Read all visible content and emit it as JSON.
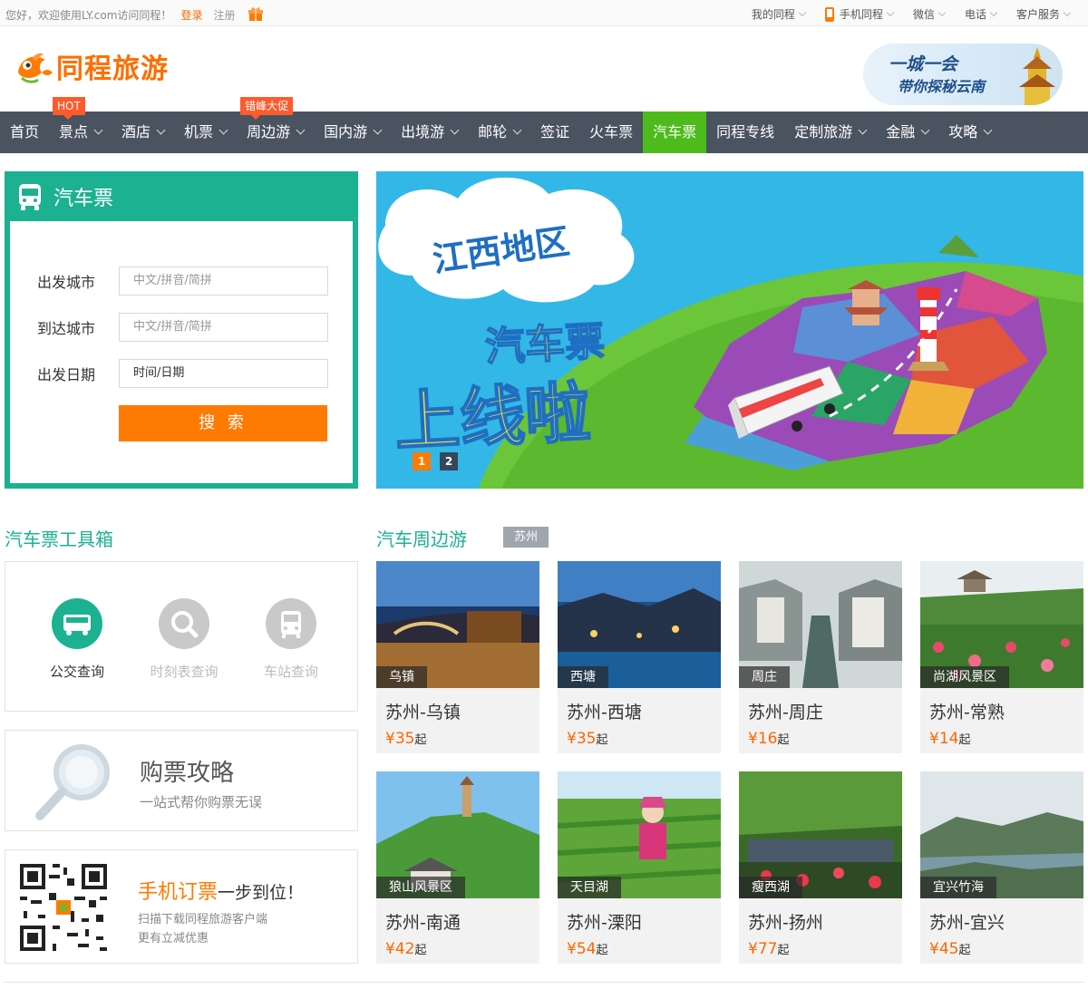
{
  "topbar": {
    "welcome": "您好，欢迎使用LY.com访问同程！",
    "login": "登录",
    "register": "注册",
    "links": [
      "我的同程",
      "手机同程",
      "微信",
      "电话",
      "客户服务"
    ]
  },
  "header": {
    "logo_text": "同程旅游",
    "promo_line1": "一城一会",
    "promo_line2": "带你探秘云南"
  },
  "nav": {
    "items": [
      {
        "label": "首页"
      },
      {
        "label": "景点",
        "tag": "HOT"
      },
      {
        "label": "酒店"
      },
      {
        "label": "机票"
      },
      {
        "label": "周边游",
        "tag": "错峰大促"
      },
      {
        "label": "国内游"
      },
      {
        "label": "出境游"
      },
      {
        "label": "邮轮"
      },
      {
        "label": "签证"
      },
      {
        "label": "火车票"
      },
      {
        "label": "汽车票"
      },
      {
        "label": "同程专线"
      },
      {
        "label": "定制旅游"
      },
      {
        "label": "金融"
      },
      {
        "label": "攻略"
      }
    ]
  },
  "search": {
    "title": "汽车票",
    "from_label": "出发城市",
    "from_placeholder": "中文/拼音/简拼",
    "to_label": "到达城市",
    "to_placeholder": "中文/拼音/简拼",
    "date_label": "出发日期",
    "date_value": "时间/日期",
    "button": "搜 索"
  },
  "banner": {
    "region": "江西地区",
    "line1": "汽车票",
    "line2": "上线啦",
    "pages": [
      "1",
      "2"
    ],
    "active_page": 1
  },
  "toolbox": {
    "title": "汽车票工具箱",
    "tools": [
      {
        "label": "公交查询",
        "icon": "bus-icon",
        "active": true
      },
      {
        "label": "时刻表查询",
        "icon": "search-icon",
        "active": false
      },
      {
        "label": "车站查询",
        "icon": "station-icon",
        "active": false
      }
    ]
  },
  "guide": {
    "title": "购票攻略",
    "subtitle": "一站式帮你购票无误"
  },
  "mobile": {
    "title_highlight": "手机订票",
    "title_rest": "一步到位！",
    "line1": "扫描下载同程旅游客户端",
    "line2": "更有立减优惠"
  },
  "nearby": {
    "title": "汽车周边游",
    "city": "苏州",
    "cards": [
      {
        "place": "乌镇",
        "route": "苏州-乌镇",
        "price": "¥35",
        "suffix": "起"
      },
      {
        "place": "西塘",
        "route": "苏州-西塘",
        "price": "¥35",
        "suffix": "起"
      },
      {
        "place": "周庄",
        "route": "苏州-周庄",
        "price": "¥16",
        "suffix": "起"
      },
      {
        "place": "尚湖风景区",
        "route": "苏州-常熟",
        "price": "¥14",
        "suffix": "起"
      },
      {
        "place": "狼山风景区",
        "route": "苏州-南通",
        "price": "¥42",
        "suffix": "起"
      },
      {
        "place": "天目湖",
        "route": "苏州-溧阳",
        "price": "¥54",
        "suffix": "起"
      },
      {
        "place": "瘦西湖",
        "route": "苏州-扬州",
        "price": "¥77",
        "suffix": "起"
      },
      {
        "place": "宜兴竹海",
        "route": "苏州-宜兴",
        "price": "¥45",
        "suffix": "起"
      }
    ]
  },
  "colors": {
    "brand_orange": "#ff7a00",
    "teal": "#1bb191",
    "nav_bg": "#4a5360",
    "nav_active": "#4dbb1c"
  }
}
